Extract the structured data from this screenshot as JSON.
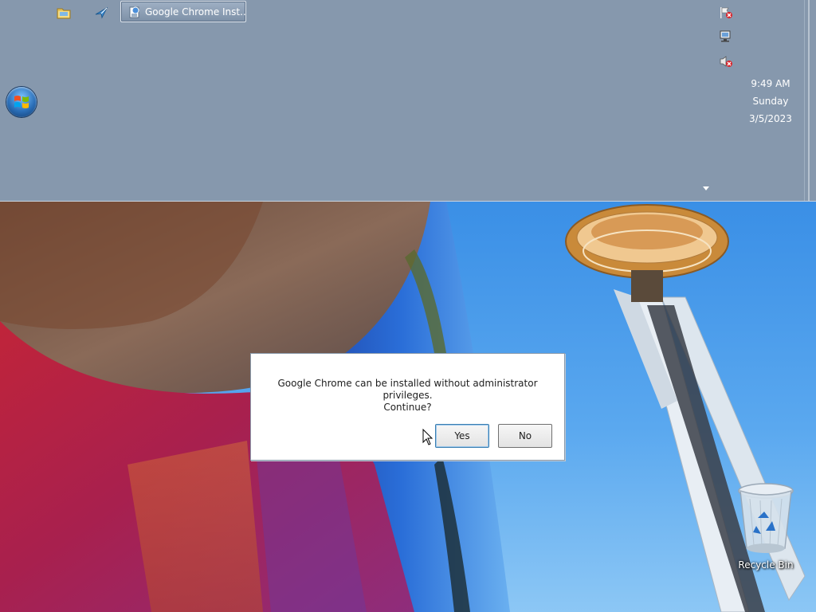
{
  "taskbar": {
    "active_task": {
      "label": "Google Chrome Inst..."
    },
    "clock": {
      "time": "9:49 AM",
      "day": "Sunday",
      "date": "3/5/2023"
    },
    "quick_launch_icons": [
      "folder-icon",
      "arrow-icon"
    ],
    "tray_icons": [
      "action-center-flag-icon",
      "network-icon",
      "volume-muted-icon"
    ]
  },
  "dialog": {
    "message_line1": "Google Chrome can be installed without administrator privileges.",
    "message_line2": "Continue?",
    "yes_label": "Yes",
    "no_label": "No"
  },
  "desktop": {
    "recycle_bin_label": "Recycle Bin"
  },
  "colors": {
    "taskbar": "#8698ad",
    "dialog_background": "#ffffff",
    "sky": "#4a9cec"
  }
}
